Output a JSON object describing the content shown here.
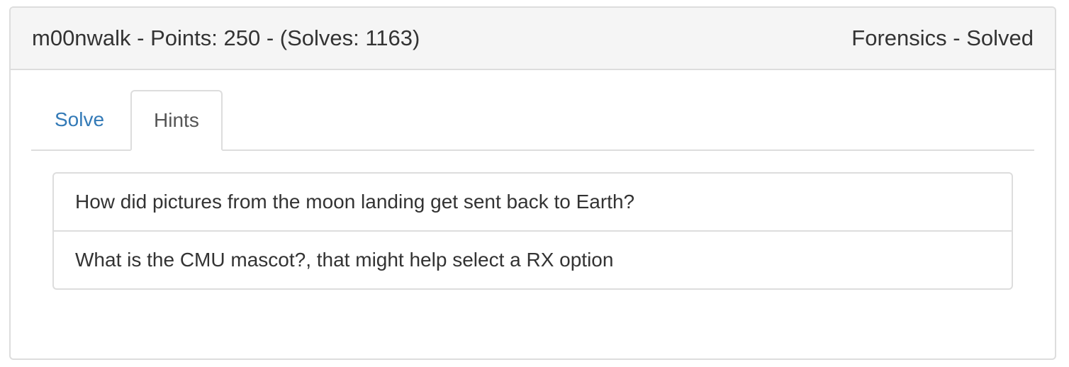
{
  "challenge": {
    "title": "m00nwalk - Points: 250 - (Solves: 1163)",
    "category_status": "Forensics - Solved"
  },
  "tabs": [
    {
      "label": "Solve",
      "active": false
    },
    {
      "label": "Hints",
      "active": true
    }
  ],
  "hints": [
    "How did pictures from the moon landing get sent back to Earth?",
    "What is the CMU mascot?, that might help select a RX option"
  ],
  "colors": {
    "link": "#337ab7",
    "border": "#dddddd",
    "heading_bg": "#f5f5f5",
    "text": "#333333"
  }
}
